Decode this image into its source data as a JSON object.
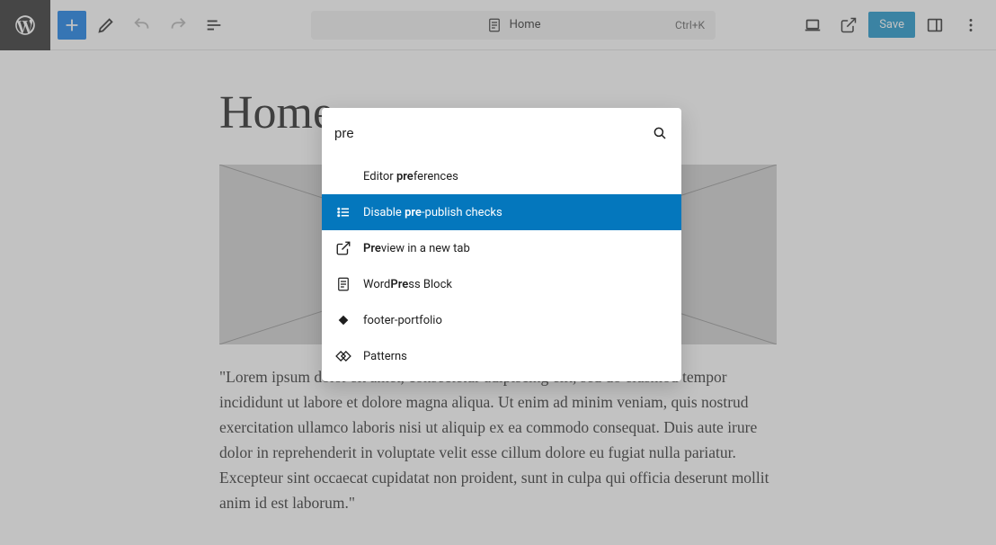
{
  "topbar": {
    "doc_title": "Home",
    "shortcut": "Ctrl+K",
    "save_label": "Save"
  },
  "page": {
    "title": "Home",
    "body": "\"Lorem ipsum dolor sit amet, consectetur adipiscing elit, sed do eiusmod tempor incididunt ut labore et dolore magna aliqua. Ut enim ad minim veniam, quis nostrud exercitation ullamco laboris nisi ut aliquip ex ea commodo consequat. Duis aute irure dolor in reprehenderit in voluptate velit esse cillum dolore eu fugiat nulla pariatur. Excepteur sint occaecat cupidatat non proident, sunt in culpa qui officia deserunt mollit anim id est laborum.\""
  },
  "palette": {
    "query": "pre",
    "items": [
      {
        "icon": "",
        "pre": "Editor ",
        "bold": "pre",
        "post": "ferences",
        "selected": false
      },
      {
        "icon": "list",
        "pre": "Disable ",
        "bold": "pre",
        "post": "-publish checks",
        "selected": true
      },
      {
        "icon": "external",
        "pre": "",
        "bold": "Pre",
        "post": "view in a new tab",
        "selected": false
      },
      {
        "icon": "page",
        "pre": "Word",
        "bold": "Pre",
        "post": "ss Block",
        "selected": false
      },
      {
        "icon": "diamond",
        "pre": "footer-portfolio",
        "bold": "",
        "post": "",
        "selected": false
      },
      {
        "icon": "diamonds",
        "pre": "Patterns",
        "bold": "",
        "post": "",
        "selected": false
      }
    ]
  },
  "colors": {
    "accent": "#0073e6",
    "selected": "#0477bd",
    "toolbar_dark": "#1e1e1e"
  }
}
